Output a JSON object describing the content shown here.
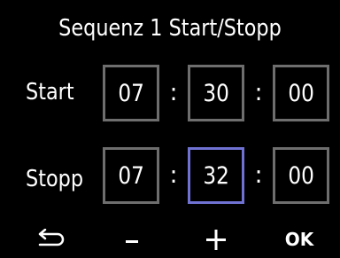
{
  "title": "Sequenz 1 Start/Stopp",
  "start": {
    "label": "Start",
    "hours": "07",
    "minutes": "30",
    "seconds": "00",
    "separator": ":"
  },
  "stop": {
    "label": "Stopp",
    "hours": "07",
    "minutes": "32",
    "seconds": "00",
    "separator": ":"
  },
  "selected_field": "stop.minutes",
  "colors": {
    "background": "#000000",
    "text": "#ffffff",
    "box_border": "#6e6e6e",
    "selected_border": "#6f72d2"
  },
  "buttons": {
    "back_icon": "back-arrow-icon",
    "minus_icon": "minus-icon",
    "plus_icon": "plus-icon",
    "ok_label": "OK"
  }
}
